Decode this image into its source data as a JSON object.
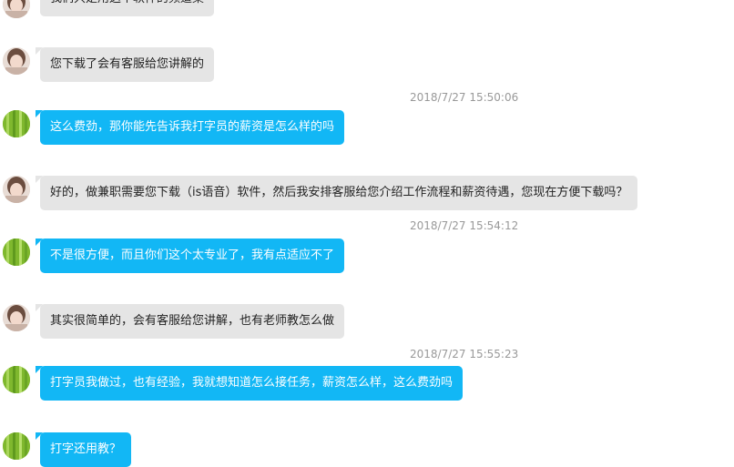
{
  "messages": [
    {
      "from": "them",
      "text": "我们只是用这个软件的频道桌"
    },
    {
      "from": "them",
      "text": "您下载了会有客服给您讲解的"
    },
    {
      "timestamp": "2018/7/27 15:50:06"
    },
    {
      "from": "me",
      "text": "这么费劲，那你能先告诉我打字员的薪资是怎么样的吗"
    },
    {
      "from": "them",
      "text": "好的，做兼职需要您下载（is语音）软件，然后我安排客服给您介绍工作流程和薪资待遇，您现在方便下载吗？"
    },
    {
      "timestamp": "2018/7/27 15:54:12"
    },
    {
      "from": "me",
      "text": "不是很方便，而且你们这个太专业了，我有点适应不了"
    },
    {
      "from": "them",
      "text": "其实很简单的，会有客服给您讲解，也有老师教怎么做"
    },
    {
      "timestamp": "2018/7/27 15:55:23"
    },
    {
      "from": "me",
      "text": "打字员我做过，也有经验，我就想知道怎么接任务，薪资怎么样，这么费劲吗"
    },
    {
      "from": "me",
      "text": "打字还用教？"
    }
  ],
  "colors": {
    "incoming_bubble": "#e5e5e5",
    "outgoing_bubble": "#12b7f5",
    "timestamp_text": "#999999"
  }
}
